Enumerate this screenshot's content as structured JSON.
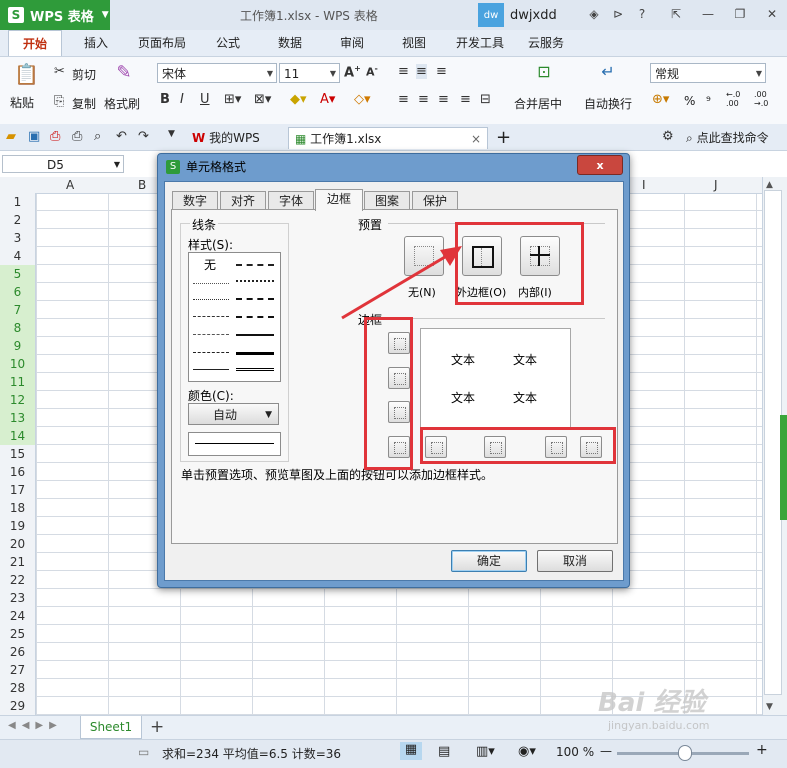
{
  "app": {
    "name": "WPS 表格",
    "doc_title": "工作簿1.xlsx - WPS 表格",
    "user_avatar": "dw",
    "user_name": "dwjxdd"
  },
  "menu": [
    "开始",
    "插入",
    "页面布局",
    "公式",
    "数据",
    "审阅",
    "视图",
    "开发工具",
    "云服务"
  ],
  "ribbon": {
    "paste": "粘贴",
    "cut": "剪切",
    "copy": "复制",
    "format_painter": "格式刷",
    "font_name": "宋体",
    "font_size": "11",
    "merge_center": "合并居中",
    "wrap_text": "自动换行",
    "number_format": "常规",
    "percent": "%",
    "comma": "⁹",
    "inc_decimal": "←.0 .00",
    "dec_decimal": ".00 →.0"
  },
  "doc_tabs": {
    "home": "我的WPS",
    "current": "工作簿1.xlsx",
    "search": "点此查找命令"
  },
  "formula_bar": {
    "cell_ref": "D5"
  },
  "columns": [
    "A",
    "B",
    "C",
    "D",
    "E",
    "F",
    "G",
    "H",
    "I",
    "J"
  ],
  "rows": [
    "1",
    "2",
    "3",
    "4",
    "5",
    "6",
    "7",
    "8",
    "9",
    "10",
    "11",
    "12",
    "13",
    "14",
    "15",
    "16",
    "17",
    "18",
    "19",
    "20",
    "21",
    "22",
    "23",
    "24",
    "25",
    "26",
    "27",
    "28",
    "29"
  ],
  "selected_rows": [
    "5",
    "6",
    "7",
    "8",
    "9",
    "10",
    "11",
    "12",
    "13",
    "14"
  ],
  "sheet_tab": "Sheet1",
  "status": {
    "summary": "求和=234  平均值=6.5  计数=36",
    "zoom": "100 %"
  },
  "watermark": {
    "logo": "Bai 经验",
    "url": "jingyan.baidu.com"
  },
  "dialog": {
    "title": "单元格格式",
    "close": "x",
    "tabs": [
      "数字",
      "对齐",
      "字体",
      "边框",
      "图案",
      "保护"
    ],
    "active_tab": "边框",
    "line_group": "线条",
    "style_label": "样式(S):",
    "style_none": "无",
    "color_label": "颜色(C):",
    "color_value": "自动",
    "preset_group": "预置",
    "preset_none": "无(N)",
    "preset_outline": "外边框(O)",
    "preset_inside": "内部(I)",
    "border_group": "边框",
    "preview_text": "文本",
    "hint": "单击预置选项、预览草图及上面的按钮可以添加边框样式。",
    "ok": "确定",
    "cancel": "取消"
  }
}
